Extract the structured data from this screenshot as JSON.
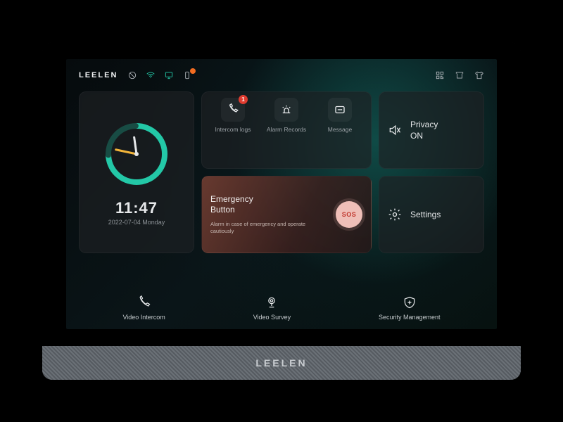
{
  "brand": "LEELEN",
  "speaker_brand": "LEELEN",
  "clock": {
    "time": "11:47",
    "date": "2022-07-04   Monday"
  },
  "triple": {
    "items": [
      {
        "label": "Intercom logs",
        "badge": "1"
      },
      {
        "label": "Alarm Records",
        "badge": null
      },
      {
        "label": "Message",
        "badge": null
      }
    ]
  },
  "emergency": {
    "title_l1": "Emergency",
    "title_l2": "Button",
    "sub": "Alarm in case of emergency and operate cautiously",
    "sos": "SOS"
  },
  "privacy": {
    "line1": "Privacy",
    "line2": "ON"
  },
  "settings": {
    "label": "Settings"
  },
  "bottom": [
    {
      "label": "Video Intercom"
    },
    {
      "label": "Video Survey"
    },
    {
      "label": "Security Management"
    }
  ],
  "colors": {
    "accent": "#23c8a7",
    "accent2": "#f3b53a",
    "danger": "#e03b2f"
  }
}
